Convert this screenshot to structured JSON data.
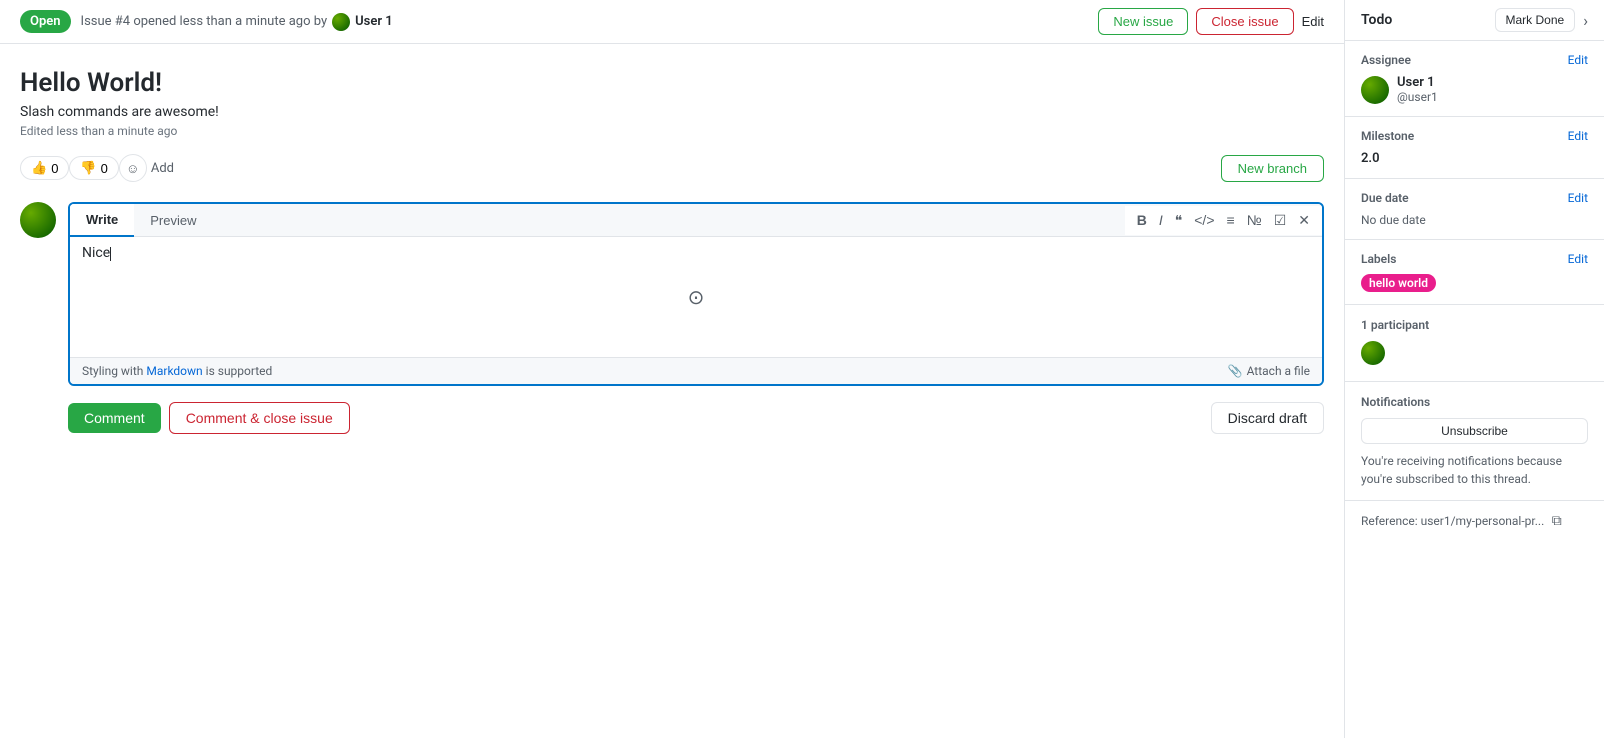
{
  "header": {
    "open_badge": "Open",
    "issue_meta": "Issue #4 opened less than a minute ago by",
    "username": "User 1",
    "new_issue_label": "New issue",
    "close_issue_label": "Close issue",
    "edit_label": "Edit"
  },
  "issue": {
    "title": "Hello World!",
    "description": "Slash commands are awesome!",
    "edited": "Edited less than a minute ago",
    "thumbs_up_count": "0",
    "thumbs_down_count": "0",
    "add_reaction_label": "Add",
    "new_branch_label": "New branch"
  },
  "editor": {
    "write_tab": "Write",
    "preview_tab": "Preview",
    "content": "Nice",
    "styling_text": "Styling with",
    "markdown_label": "Markdown",
    "supported_text": "is supported",
    "attach_label": "Attach a file"
  },
  "actions": {
    "comment_label": "Comment",
    "comment_close_label": "Comment & close issue",
    "discard_label": "Discard draft"
  },
  "sidebar": {
    "todo_label": "Todo",
    "mark_done_label": "Mark Done",
    "assignee_section": "Assignee",
    "assignee_edit": "Edit",
    "assignee_name": "User 1",
    "assignee_handle": "@user1",
    "milestone_section": "Milestone",
    "milestone_edit": "Edit",
    "milestone_value": "2.0",
    "due_date_section": "Due date",
    "due_date_edit": "Edit",
    "due_date_value": "No due date",
    "labels_section": "Labels",
    "labels_edit": "Edit",
    "label_text": "hello world",
    "label_color": "#e91e8c",
    "participants_count": "1 participant",
    "notifications_section": "Notifications",
    "unsubscribe_label": "Unsubscribe",
    "notification_info": "You're receiving notifications because you're subscribed to this thread.",
    "reference_label": "Reference: user1/my-personal-pr..."
  }
}
